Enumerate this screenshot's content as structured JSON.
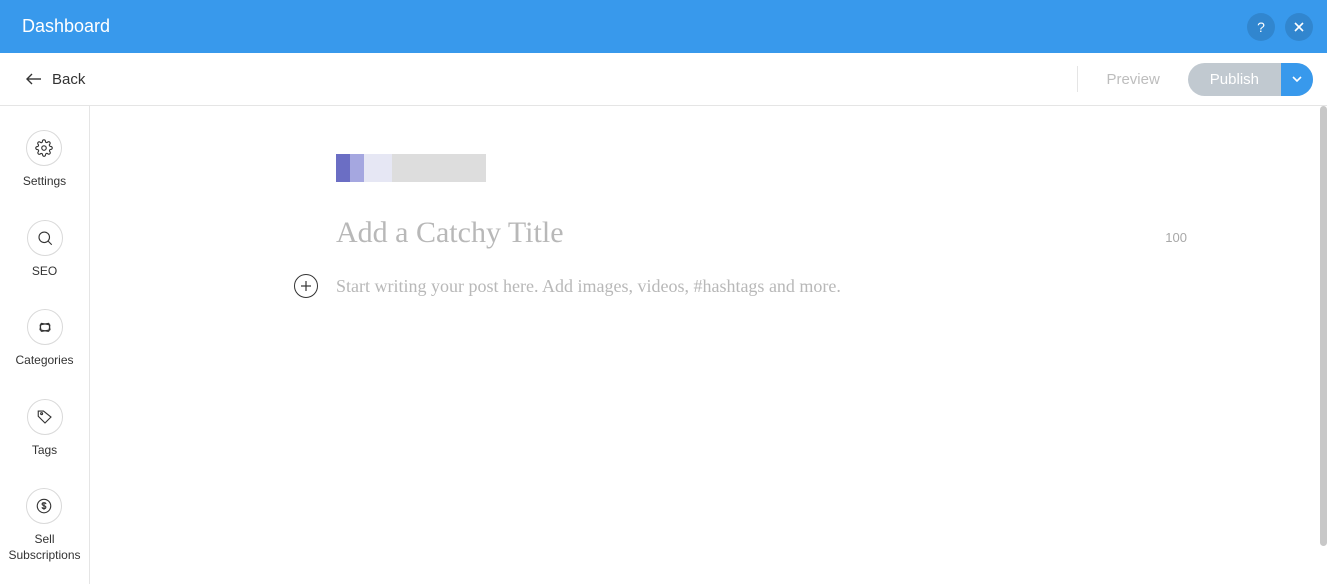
{
  "header": {
    "title": "Dashboard"
  },
  "topbar": {
    "back_label": "Back",
    "preview_label": "Preview",
    "publish_label": "Publish"
  },
  "sidebar": {
    "items": [
      {
        "key": "settings",
        "label": "Settings",
        "icon": "gear-icon"
      },
      {
        "key": "seo",
        "label": "SEO",
        "icon": "search-icon"
      },
      {
        "key": "categories",
        "label": "Categories",
        "icon": "cards-icon"
      },
      {
        "key": "tags",
        "label": "Tags",
        "icon": "tag-icon"
      },
      {
        "key": "sell",
        "label": "Sell\nSubscriptions",
        "icon": "dollar-icon"
      }
    ]
  },
  "editor": {
    "title_placeholder": "Add a Catchy Title",
    "title_char_limit": "100",
    "body_placeholder": "Start writing your post here. Add images, videos, #hashtags and more."
  }
}
